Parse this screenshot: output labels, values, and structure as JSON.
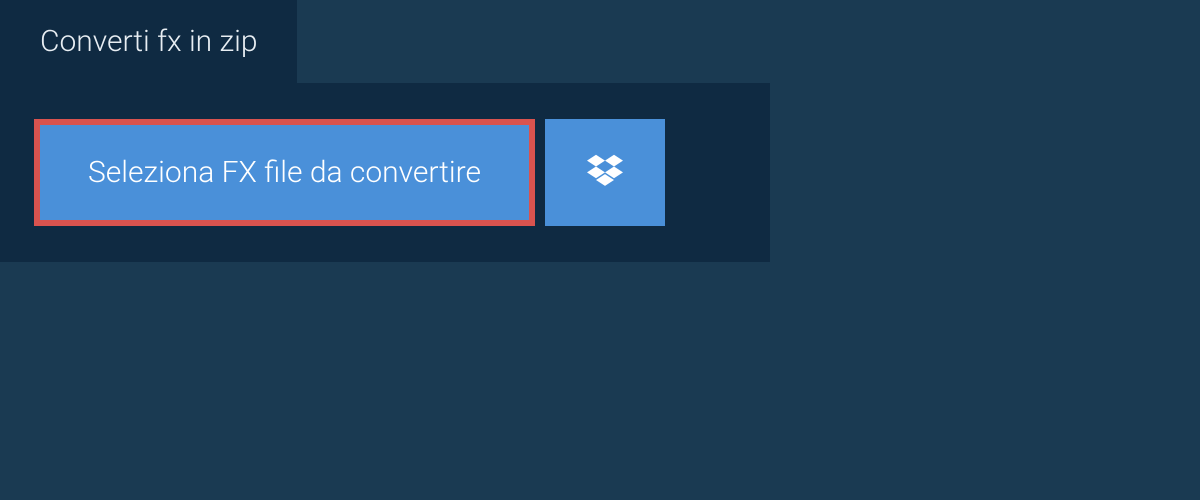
{
  "tab": {
    "label": "Converti fx in zip"
  },
  "buttons": {
    "select_file": "Seleziona FX file da convertire"
  }
}
